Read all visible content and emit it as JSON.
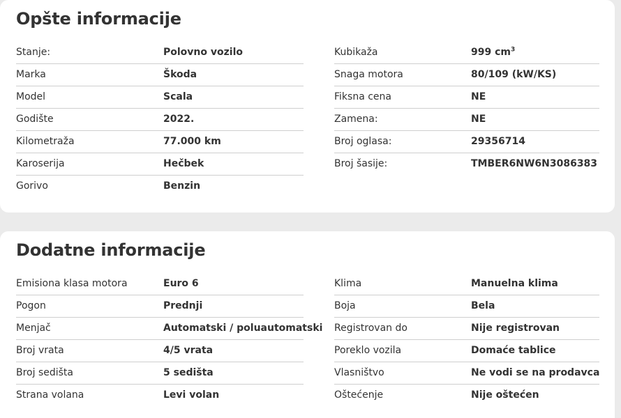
{
  "general": {
    "title": "Opšte informacije",
    "left": [
      {
        "label": "Stanje:",
        "value": "Polovno vozilo"
      },
      {
        "label": "Marka",
        "value": "Škoda"
      },
      {
        "label": "Model",
        "value": "Scala"
      },
      {
        "label": "Godište",
        "value": "2022."
      },
      {
        "label": "Kilometraža",
        "value": "77.000 km"
      },
      {
        "label": "Karoserija",
        "value": "Hečbek"
      },
      {
        "label": "Gorivo",
        "value": "Benzin"
      }
    ],
    "right": [
      {
        "label": "Kubikaža",
        "value": "999 cm",
        "value_sup": "3"
      },
      {
        "label": "Snaga motora",
        "value": "80/109 (kW/KS)"
      },
      {
        "label": "Fiksna cena",
        "value": "NE"
      },
      {
        "label": "Zamena:",
        "value": "NE"
      },
      {
        "label": "Broj oglasa:",
        "value": "29356714"
      },
      {
        "label": "Broj šasije:",
        "value": "TMBER6NW6N3086383"
      }
    ]
  },
  "additional": {
    "title": "Dodatne informacije",
    "left": [
      {
        "label": "Emisiona klasa motora",
        "value": "Euro 6"
      },
      {
        "label": "Pogon",
        "value": "Prednji"
      },
      {
        "label": "Menjač",
        "value": "Automatski / poluautomatski"
      },
      {
        "label": "Broj vrata",
        "value": "4/5 vrata"
      },
      {
        "label": "Broj sedišta",
        "value": "5 sedišta"
      },
      {
        "label": "Strana volana",
        "value": "Levi volan"
      }
    ],
    "right": [
      {
        "label": "Klima",
        "value": "Manuelna klima"
      },
      {
        "label": "Boja",
        "value": "Bela"
      },
      {
        "label": "Registrovan do",
        "value": "Nije registrovan"
      },
      {
        "label": "Poreklo vozila",
        "value": "Domaće tablice"
      },
      {
        "label": "Vlasništvo",
        "value": "Ne vodi se na prodavca"
      },
      {
        "label": "Oštećenje",
        "value": "Nije oštećen"
      }
    ]
  }
}
